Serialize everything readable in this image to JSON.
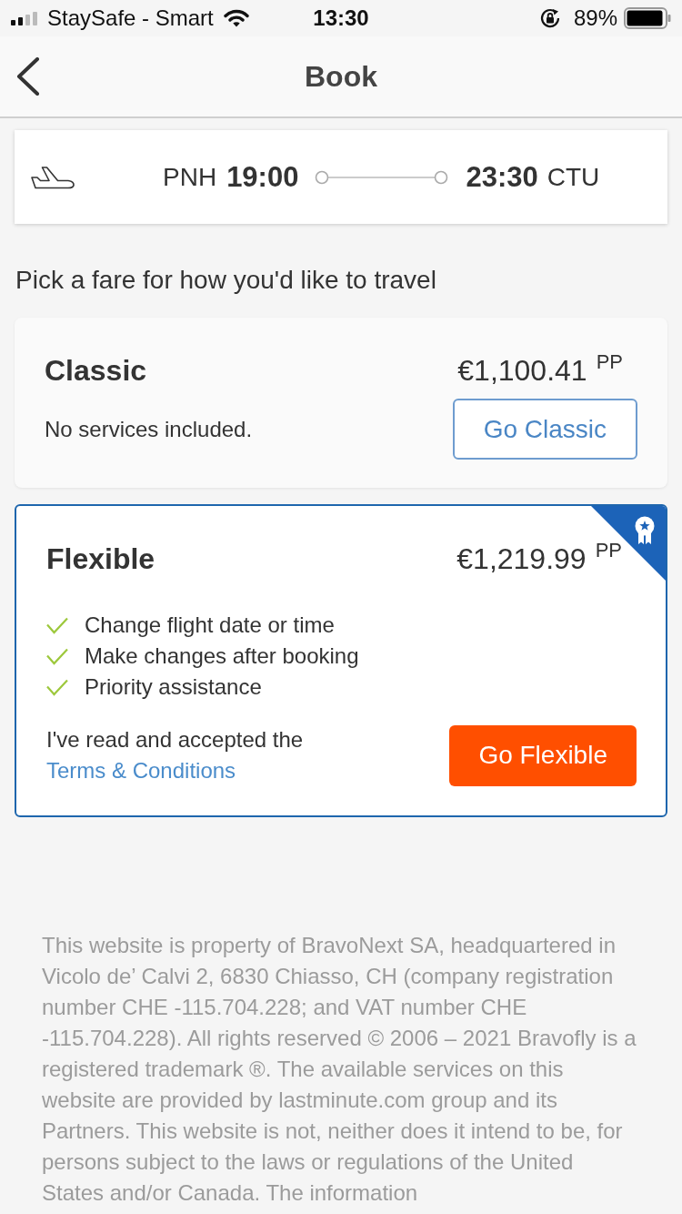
{
  "status_bar": {
    "carrier": "StaySafe - Smart",
    "time": "13:30",
    "battery": "89%"
  },
  "nav_bar": {
    "title": "Book"
  },
  "flight": {
    "origin": "PNH",
    "departure_time": "19:00",
    "arrival_time": "23:30",
    "destination": "CTU"
  },
  "heading": "Pick a fare for how you'd like to travel",
  "fares": [
    {
      "name": "Classic",
      "price": "€1,100.41",
      "price_unit": "PP",
      "recommended": false,
      "description": "No services included.",
      "button": "Go Classic"
    },
    {
      "name": "Flexible",
      "price": "€1,219.99",
      "price_unit": "PP",
      "recommended": true,
      "features": [
        "Change flight date or time",
        "Make changes after booking",
        "Priority assistance"
      ],
      "terms": {
        "text": "I've read and accepted the",
        "link": "Terms & Conditions"
      },
      "button": "Go Flexible"
    }
  ],
  "legal_text": "This website is property of BravoNext SA, headquartered in Vicolo de’ Calvi 2, 6830 Chiasso, CH (company registration number CHE -115.704.228; and VAT number CHE -115.704.228). All rights reserved © 2006 – 2021 Bravofly is a registered trademark ®. The available services on this website are provided by lastminute.com group and its Partners. This website is not, neither does it intend to be, for persons subject to the laws or regulations of the United States and/or Canada. The information"
}
